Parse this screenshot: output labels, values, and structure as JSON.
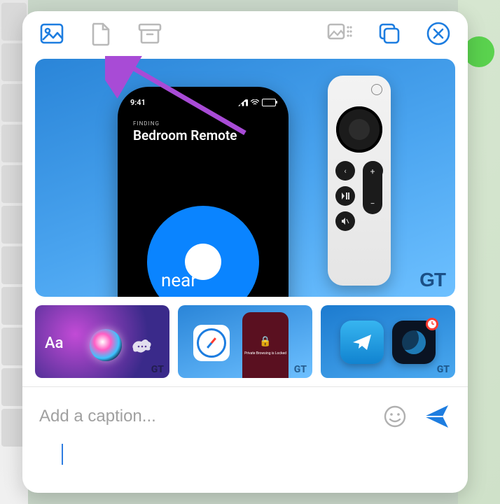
{
  "toolbar": {
    "photo_icon": "photo-icon",
    "file_icon": "file-icon",
    "archive_icon": "archive-icon",
    "group_icon": "group-media-icon",
    "copy_icon": "copy-icon",
    "close_icon": "close-icon"
  },
  "hero": {
    "phone_time": "9:41",
    "finding_label": "FINDING",
    "device_name": "Bedroom Remote",
    "proximity_label": "near",
    "watermark": "GT"
  },
  "thumbnails": [
    {
      "id": "siri-text",
      "aa_label": "Aa",
      "watermark": "GT"
    },
    {
      "id": "safari-private",
      "lock_label": "🔒",
      "lock_text": "Private Browsing is Locked",
      "watermark": "GT"
    },
    {
      "id": "telegram-dnd",
      "watermark": "GT"
    }
  ],
  "caption": {
    "placeholder": "Add a caption...",
    "value": ""
  }
}
